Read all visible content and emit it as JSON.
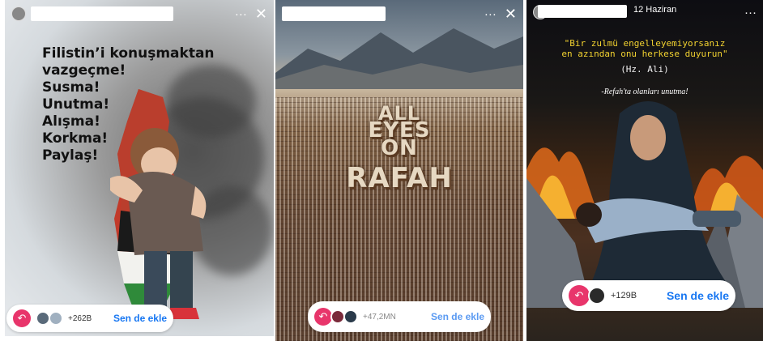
{
  "stories": [
    {
      "id": "story-1",
      "poster_lines": [
        "Filistin’i konuşmaktan",
        "vazgeçme!",
        "Susma!",
        "Unutma!",
        "Alışma!",
        "Korkma!",
        "Paylaş!"
      ],
      "footer": {
        "count": "+262B",
        "add_label": "Sen de ekle"
      },
      "header": {
        "more": "···",
        "close": "✕"
      }
    },
    {
      "id": "story-2",
      "image_text": [
        "ALL",
        "EYES",
        "ON",
        "RAFAH"
      ],
      "footer": {
        "count": "+47,2MN",
        "add_label": "Sen de ekle"
      },
      "header": {
        "more": "···",
        "close": "✕"
      }
    },
    {
      "id": "story-3",
      "header": {
        "date": "12 Haziran",
        "more": "···"
      },
      "quote_line1": "\"Bir zulmü engelleyemiyorsanız",
      "quote_line2": "en azından onu herkese duyurun\"",
      "quote_author": "(Hz. Ali)",
      "caption": "-Refah'ta olanları unutma!",
      "footer": {
        "count": "+129B",
        "add_label": "Sen de ekle"
      }
    }
  ],
  "colors": {
    "accent_blue": "#1877f2",
    "reply_pink": "#e8356b",
    "quote_yellow": "#f2d230"
  }
}
